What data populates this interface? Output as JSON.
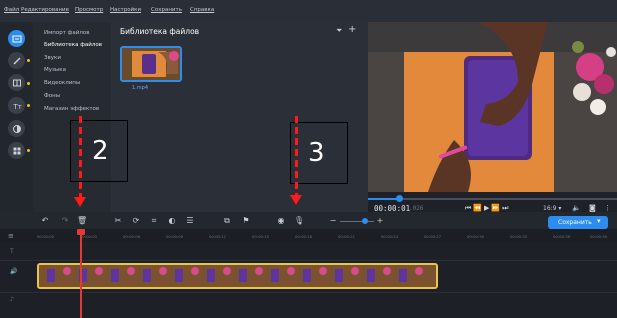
{
  "menu": {
    "items": [
      "Файл",
      "Редактирование",
      "Просмотр",
      "Настройки",
      "Сохранить",
      "Справка"
    ]
  },
  "toolrail": {
    "icons": [
      "import-icon",
      "magic-wand-icon",
      "transitions-icon",
      "text-icon",
      "filters-icon",
      "more-tools-icon"
    ]
  },
  "sidebar": {
    "items": [
      "Импорт файлов",
      "Библиотека файлов",
      "Звуки",
      "Музыка",
      "Видеоклипы",
      "Фоны",
      "Магазин эффектов"
    ],
    "active_index": 1
  },
  "library": {
    "title": "Библиотека файлов",
    "file_label": "1.mp4"
  },
  "player": {
    "timecode": "00:00:01",
    "timecode_ms": ".026",
    "aspect": "16:9 ▾",
    "progress": 0.12
  },
  "toolbar": {
    "save_label": "Сохранить"
  },
  "ruler": {
    "ticks": [
      "00:00:00",
      "00:00:03",
      "00:00:06",
      "00:00:09",
      "00:00:12",
      "00:00:15",
      "00:00:18",
      "00:00:21",
      "00:00:24",
      "00:00:27",
      "00:00:30",
      "00:00:33",
      "00:00:36",
      "00:00:39",
      "00:00:42"
    ]
  },
  "annotations": {
    "label_2": "2",
    "label_3": "3"
  },
  "colors": {
    "accent": "#2d8cf0",
    "playhead": "#e53935",
    "clip_border": "#e9c64a",
    "annotation": "#ff1a1a"
  }
}
